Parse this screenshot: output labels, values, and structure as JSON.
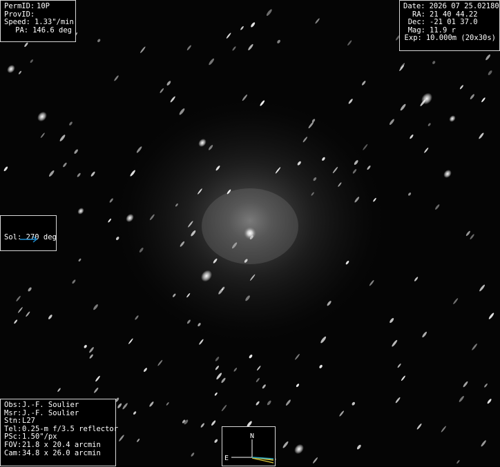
{
  "object_info": {
    "rows": [
      {
        "key": "PermID:",
        "value": "10P"
      },
      {
        "key": "ProvID:",
        "value": ""
      },
      {
        "key": "Speed:",
        "value": "1.33\"/min"
      },
      {
        "key": "PA:",
        "value": "146.6 deg"
      }
    ]
  },
  "obs_info": {
    "rows": [
      {
        "key": "Date:",
        "value": "2026 07 25.02180"
      },
      {
        "key": "RA:",
        "value": "21 40 44.22"
      },
      {
        "key": "Dec:",
        "value": "-21 01 37.0"
      },
      {
        "key": "Mag:",
        "value": "11.9 r"
      },
      {
        "key": "Exp:",
        "value": "10.000m (20x30s)"
      }
    ]
  },
  "sun_direction": {
    "label": "Sol: 270 deg",
    "arrow_icon": "arrow-right-icon",
    "arrow_color": "#1e90d6"
  },
  "observer_info": {
    "rows": [
      {
        "key": "Obs:",
        "value": "J.-F. Soulier"
      },
      {
        "key": "Msr:",
        "value": "J.-F. Soulier"
      },
      {
        "key": "Stn:",
        "value": "L27"
      },
      {
        "key": "Tel:",
        "value": "0.25-m f/3.5 reflector"
      },
      {
        "key": "PSc:",
        "value": "1.50\"/px"
      },
      {
        "key": "FOV:",
        "value": "21.8 x 20.4 arcmin"
      },
      {
        "key": "Cam:",
        "value": "34.8 x 26.0 arcmin"
      }
    ]
  },
  "compass": {
    "north_label": "N",
    "east_label": "E",
    "colors": {
      "axes": "#ffffff",
      "motion": "#e6d23a",
      "pa": "#2aa6c8"
    }
  }
}
